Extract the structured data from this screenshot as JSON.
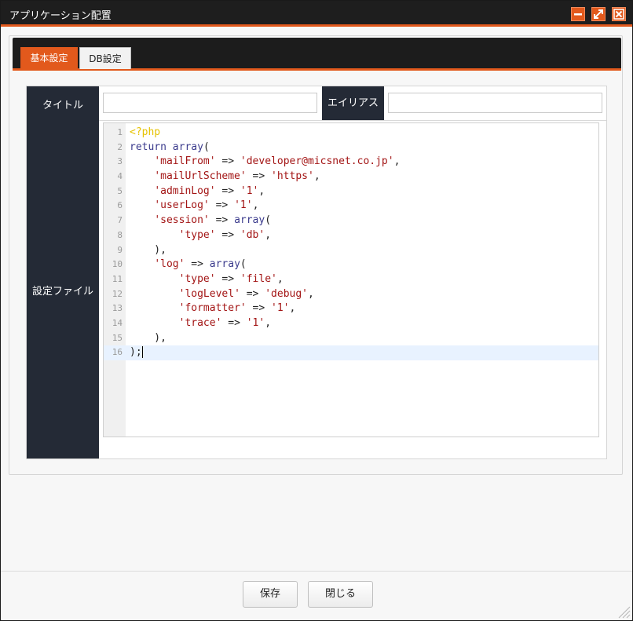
{
  "window": {
    "title": "アプリケーション配置",
    "controls": [
      "minimize-icon",
      "maximize-icon",
      "close-icon"
    ],
    "accent_color": "#e2591c"
  },
  "tabs": [
    {
      "label": "基本設定",
      "active": true
    },
    {
      "label": "DB設定",
      "active": false
    }
  ],
  "form": {
    "title_label": "タイトル",
    "title_value": "",
    "alias_label": "エイリアス",
    "alias_value": "",
    "config_label": "設定ファイル"
  },
  "editor": {
    "lines": [
      "<?php",
      "return array(",
      "    'mailFrom' => 'developer@micsnet.co.jp',",
      "    'mailUrlScheme' => 'https',",
      "    'adminLog' => '1',",
      "    'userLog' => '1',",
      "    'session' => array(",
      "        'type' => 'db',",
      "    ),",
      "    'log' => array(",
      "        'type' => 'file',",
      "        'logLevel' => 'debug',",
      "        'formatter' => '1',",
      "        'trace' => '1',",
      "    ),",
      ");"
    ],
    "active_line": 16
  },
  "footer": {
    "save_label": "保存",
    "close_label": "閉じる"
  }
}
